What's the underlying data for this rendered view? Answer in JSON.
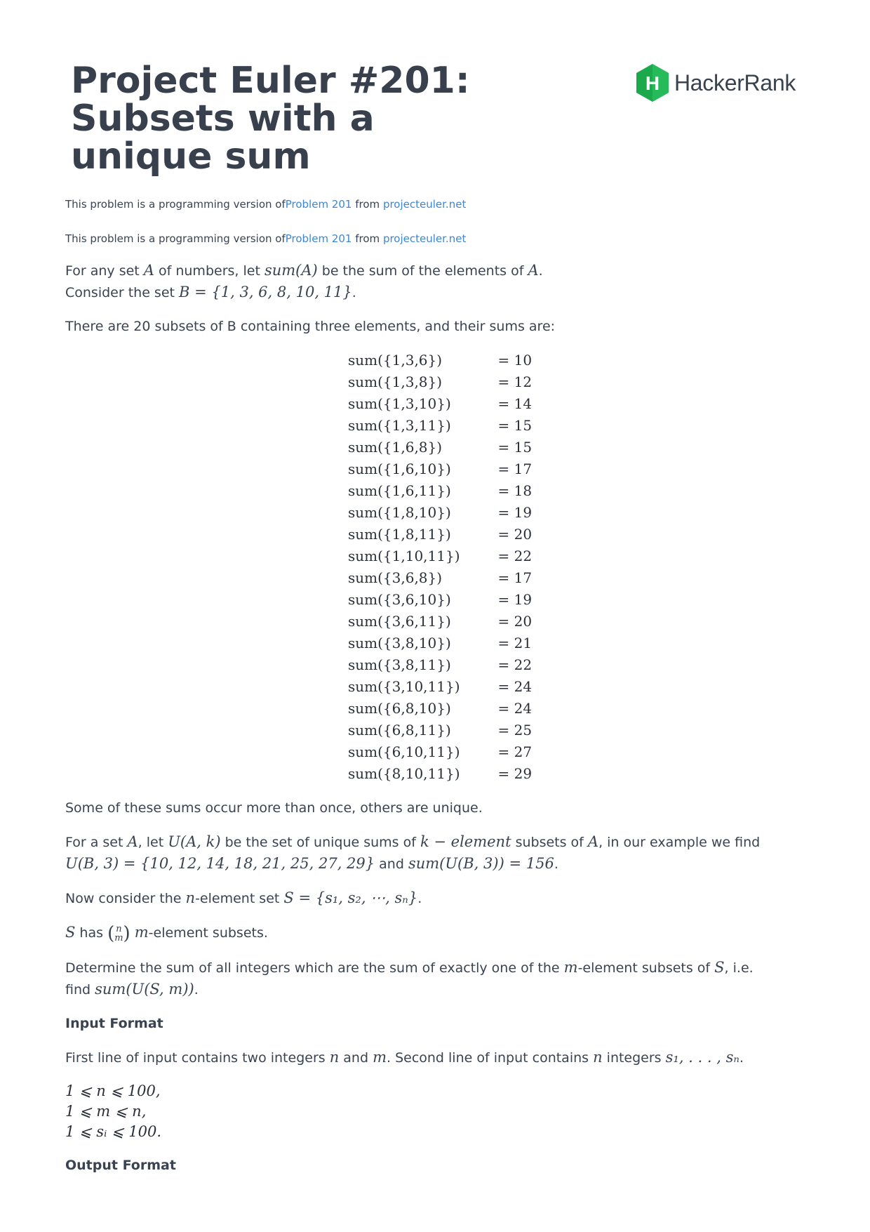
{
  "header": {
    "title": "Project Euler #201: Subsets with a unique sum",
    "logo_text": "HackerRank",
    "logo_letter": "H"
  },
  "source_note": {
    "prefix": "This problem is a programming version of",
    "link1": "Problem 201",
    "middle": "from",
    "link2": "projecteuler.net"
  },
  "intro": {
    "p1a": "For any set ",
    "A": "A",
    "p1b": " of numbers, let ",
    "sumA": "sum(A)",
    "p1c": " be the sum of the elements of ",
    "p1d": ".",
    "p2a": "Consider the set ",
    "B_def": "B = {1, 3, 6, 8, 10, 11}",
    "p2b": "."
  },
  "subsets_intro": "There are 20 subsets of B containing three elements, and their sums are:",
  "sums_table": [
    {
      "expr": "sum({1,3,6})",
      "result": "= 10"
    },
    {
      "expr": "sum({1,3,8})",
      "result": "= 12"
    },
    {
      "expr": "sum({1,3,10})",
      "result": "= 14"
    },
    {
      "expr": "sum({1,3,11})",
      "result": "= 15"
    },
    {
      "expr": "sum({1,6,8})",
      "result": "= 15"
    },
    {
      "expr": "sum({1,6,10})",
      "result": "= 17"
    },
    {
      "expr": "sum({1,6,11})",
      "result": "= 18"
    },
    {
      "expr": "sum({1,8,10})",
      "result": "= 19"
    },
    {
      "expr": "sum({1,8,11})",
      "result": "= 20"
    },
    {
      "expr": "sum({1,10,11})",
      "result": "= 22"
    },
    {
      "expr": "sum({3,6,8})",
      "result": "= 17"
    },
    {
      "expr": "sum({3,6,10})",
      "result": "= 19"
    },
    {
      "expr": "sum({3,6,11})",
      "result": "= 20"
    },
    {
      "expr": "sum({3,8,10})",
      "result": "= 21"
    },
    {
      "expr": "sum({3,8,11})",
      "result": "= 22"
    },
    {
      "expr": "sum({3,10,11})",
      "result": "= 24"
    },
    {
      "expr": "sum({6,8,10})",
      "result": "= 24"
    },
    {
      "expr": "sum({6,8,11})",
      "result": "= 25"
    },
    {
      "expr": "sum({6,10,11})",
      "result": "= 27"
    },
    {
      "expr": "sum({8,10,11})",
      "result": "= 29"
    }
  ],
  "unique_note": "Some of these sums occur more than once, others are unique.",
  "uset": {
    "a": "For a set ",
    "A": "A",
    "b": ", let ",
    "UAk": "U(A, k)",
    "c": " be the set of unique sums of ",
    "kel": "k − element",
    "d": " subsets of ",
    "e": ", in our example we find",
    "UB3": "U(B, 3) = {10, 12, 14, 18, 21, 25, 27, 29}",
    "f": " and ",
    "sumUB3": "sum(U(B, 3)) = 156",
    "g": "."
  },
  "nset": {
    "a": "Now consider the ",
    "n": "n",
    "b": "-element set ",
    "S_def": "S = {s₁, s₂, ⋯, sₙ}",
    "c": "."
  },
  "shas": {
    "S": "S",
    "a": " has ",
    "binom_n": "n",
    "binom_m": "m",
    "m": "m",
    "b": "-element subsets."
  },
  "determine": {
    "a": "Determine the sum of all integers which are the sum of exactly one of the ",
    "m": "m",
    "b": "-element subsets of ",
    "S": "S",
    "c": ", i.e.",
    "d": "find ",
    "expr": "sum(U(S, m))",
    "e": "."
  },
  "input_format": {
    "heading": "Input Format",
    "a": "First line of input contains two integers ",
    "n": "n",
    "b": " and ",
    "m": "m",
    "c": ". Second line of input contains ",
    "d": " integers ",
    "seq": "s₁, . . . , sₙ",
    "e": "."
  },
  "constraints": [
    "1 ⩽ n ⩽ 100,",
    "1 ⩽ m ⩽ n,",
    "1 ⩽ sᵢ ⩽ 100."
  ],
  "output_format": {
    "heading": "Output Format"
  },
  "colors": {
    "title": "#38404d",
    "text": "#3a4352",
    "link": "#3f86d6",
    "logo_green": "#1ba94c"
  }
}
